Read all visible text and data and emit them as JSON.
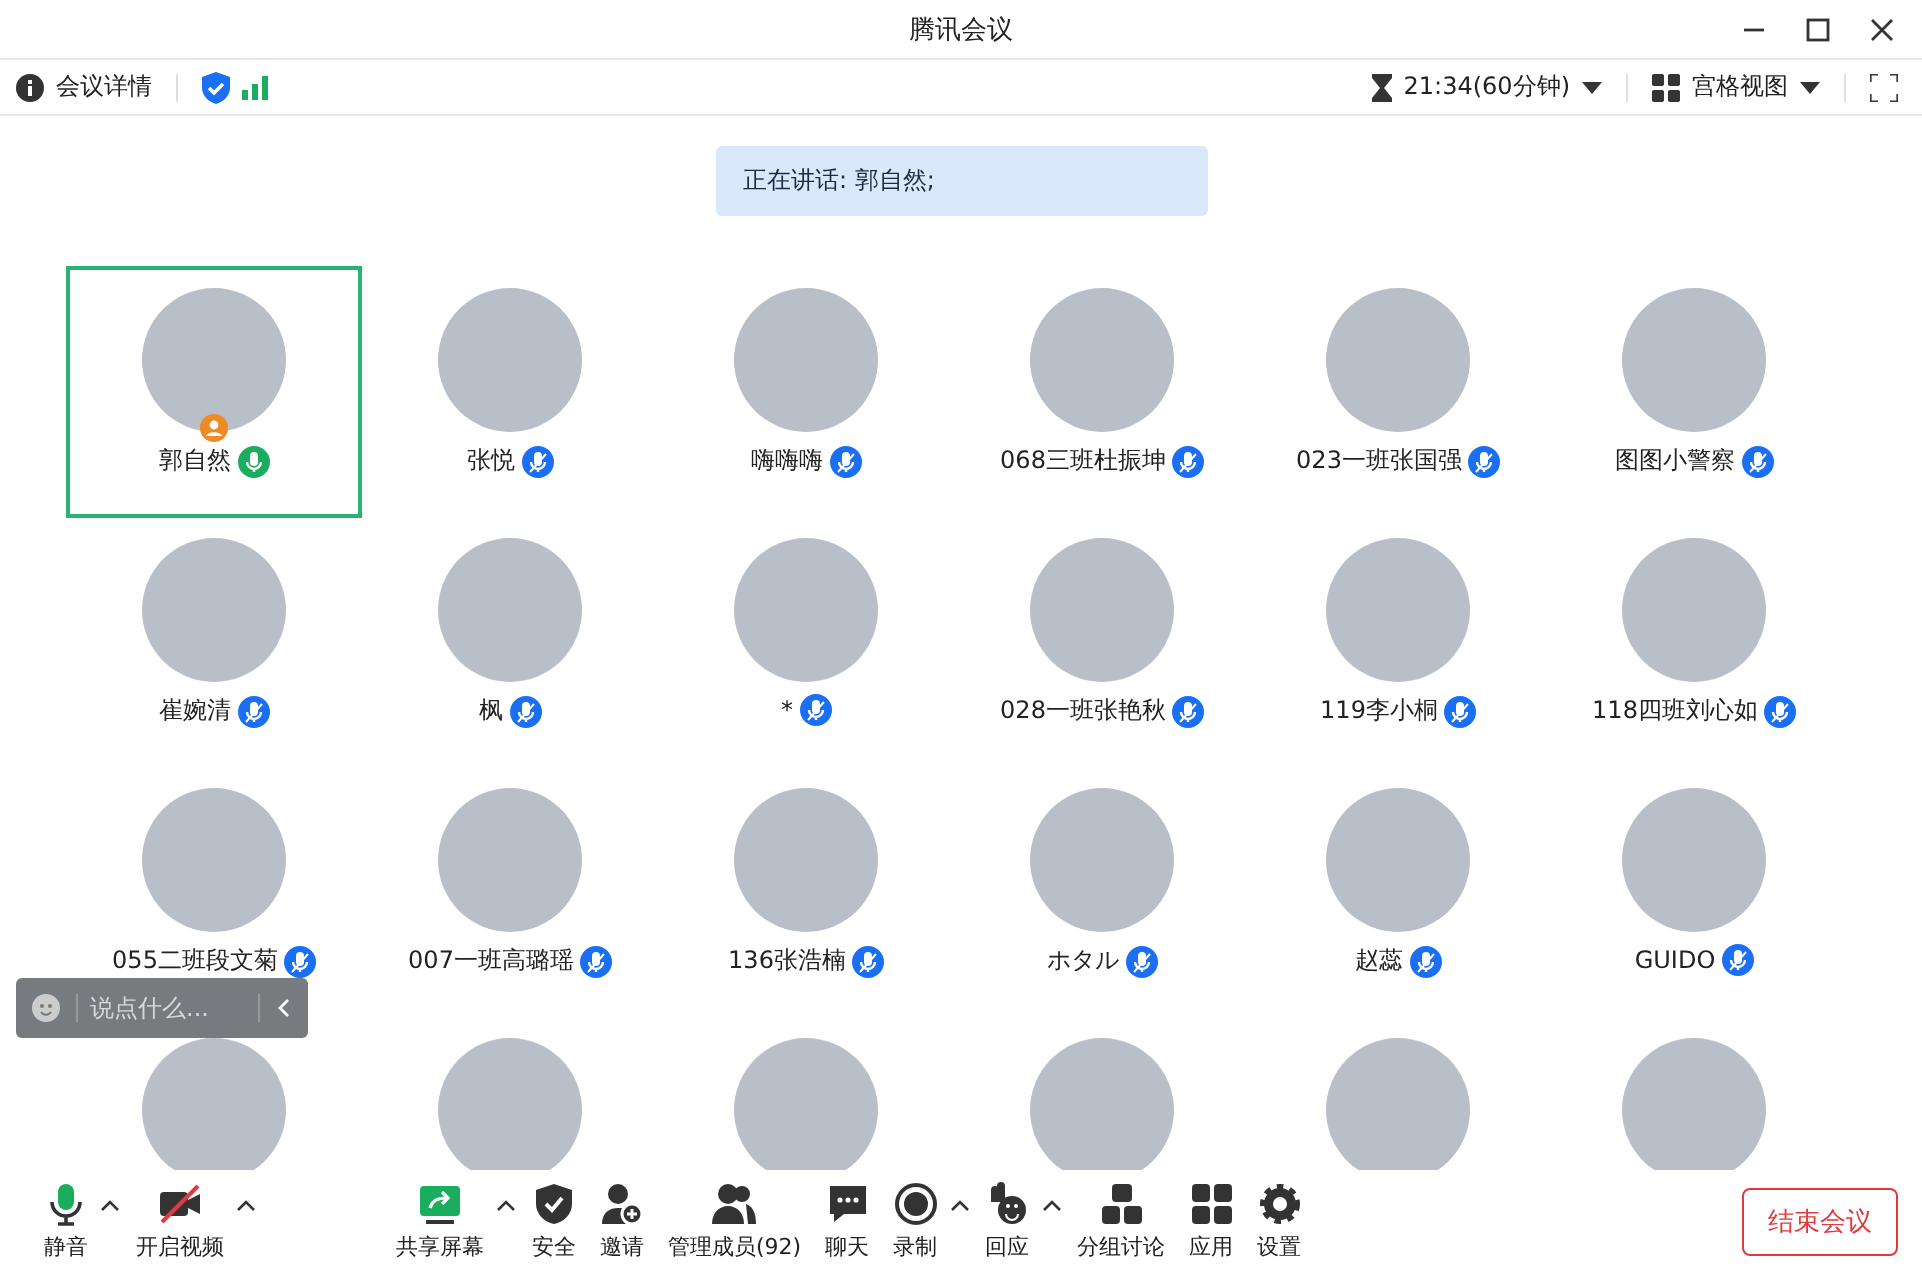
{
  "window": {
    "title": "腾讯会议"
  },
  "infobar": {
    "details": "会议详情",
    "timer": "21:34(60分钟)",
    "view": "宫格视图"
  },
  "speaker_banner": "正在讲话: 郭自然;",
  "participants": [
    {
      "name": "郭自然",
      "selected": true,
      "host": true,
      "speaking": true
    },
    {
      "name": "张悦",
      "selected": false,
      "host": false,
      "speaking": false
    },
    {
      "name": "嗨嗨嗨",
      "selected": false,
      "host": false,
      "speaking": false
    },
    {
      "name": "068三班杜振坤",
      "selected": false,
      "host": false,
      "speaking": false
    },
    {
      "name": "023一班张国强",
      "selected": false,
      "host": false,
      "speaking": false
    },
    {
      "name": "图图小警察",
      "selected": false,
      "host": false,
      "speaking": false
    },
    {
      "name": "崔婉清",
      "selected": false,
      "host": false,
      "speaking": false
    },
    {
      "name": "枫",
      "selected": false,
      "host": false,
      "speaking": false
    },
    {
      "name": "*",
      "selected": false,
      "host": false,
      "speaking": false
    },
    {
      "name": "028一班张艳秋",
      "selected": false,
      "host": false,
      "speaking": false
    },
    {
      "name": "119李小桐",
      "selected": false,
      "host": false,
      "speaking": false
    },
    {
      "name": "118四班刘心如",
      "selected": false,
      "host": false,
      "speaking": false
    },
    {
      "name": "055二班段文菊",
      "selected": false,
      "host": false,
      "speaking": false
    },
    {
      "name": "007一班高璐瑶",
      "selected": false,
      "host": false,
      "speaking": false
    },
    {
      "name": "136张浩楠",
      "selected": false,
      "host": false,
      "speaking": false
    },
    {
      "name": "ホタル",
      "selected": false,
      "host": false,
      "speaking": false
    },
    {
      "name": "赵蕊",
      "selected": false,
      "host": false,
      "speaking": false
    },
    {
      "name": "GUIDO",
      "selected": false,
      "host": false,
      "speaking": false
    },
    {
      "selected": false
    },
    {
      "selected": false
    },
    {
      "selected": false
    },
    {
      "selected": false
    },
    {
      "selected": false
    },
    {
      "selected": false
    }
  ],
  "chat_input": {
    "placeholder": "说点什么..."
  },
  "toolbar": [
    {
      "kind": "mic",
      "label": "静音",
      "menu": true
    },
    {
      "kind": "camera",
      "label": "开启视频",
      "menu": true
    },
    {
      "kind": "share",
      "label": "共享屏幕",
      "menu": true
    },
    {
      "kind": "shield",
      "label": "安全",
      "menu": false
    },
    {
      "kind": "invite",
      "label": "邀请",
      "menu": false
    },
    {
      "kind": "members",
      "label": "管理成员(92)",
      "menu": false
    },
    {
      "kind": "chat",
      "label": "聊天",
      "menu": false
    },
    {
      "kind": "record",
      "label": "录制",
      "menu": true
    },
    {
      "kind": "react",
      "label": "回应",
      "menu": true
    },
    {
      "kind": "breakout",
      "label": "分组讨论",
      "menu": false
    },
    {
      "kind": "apps",
      "label": "应用",
      "menu": false
    },
    {
      "kind": "settings",
      "label": "设置",
      "menu": false
    }
  ],
  "end_button": "结束会议"
}
